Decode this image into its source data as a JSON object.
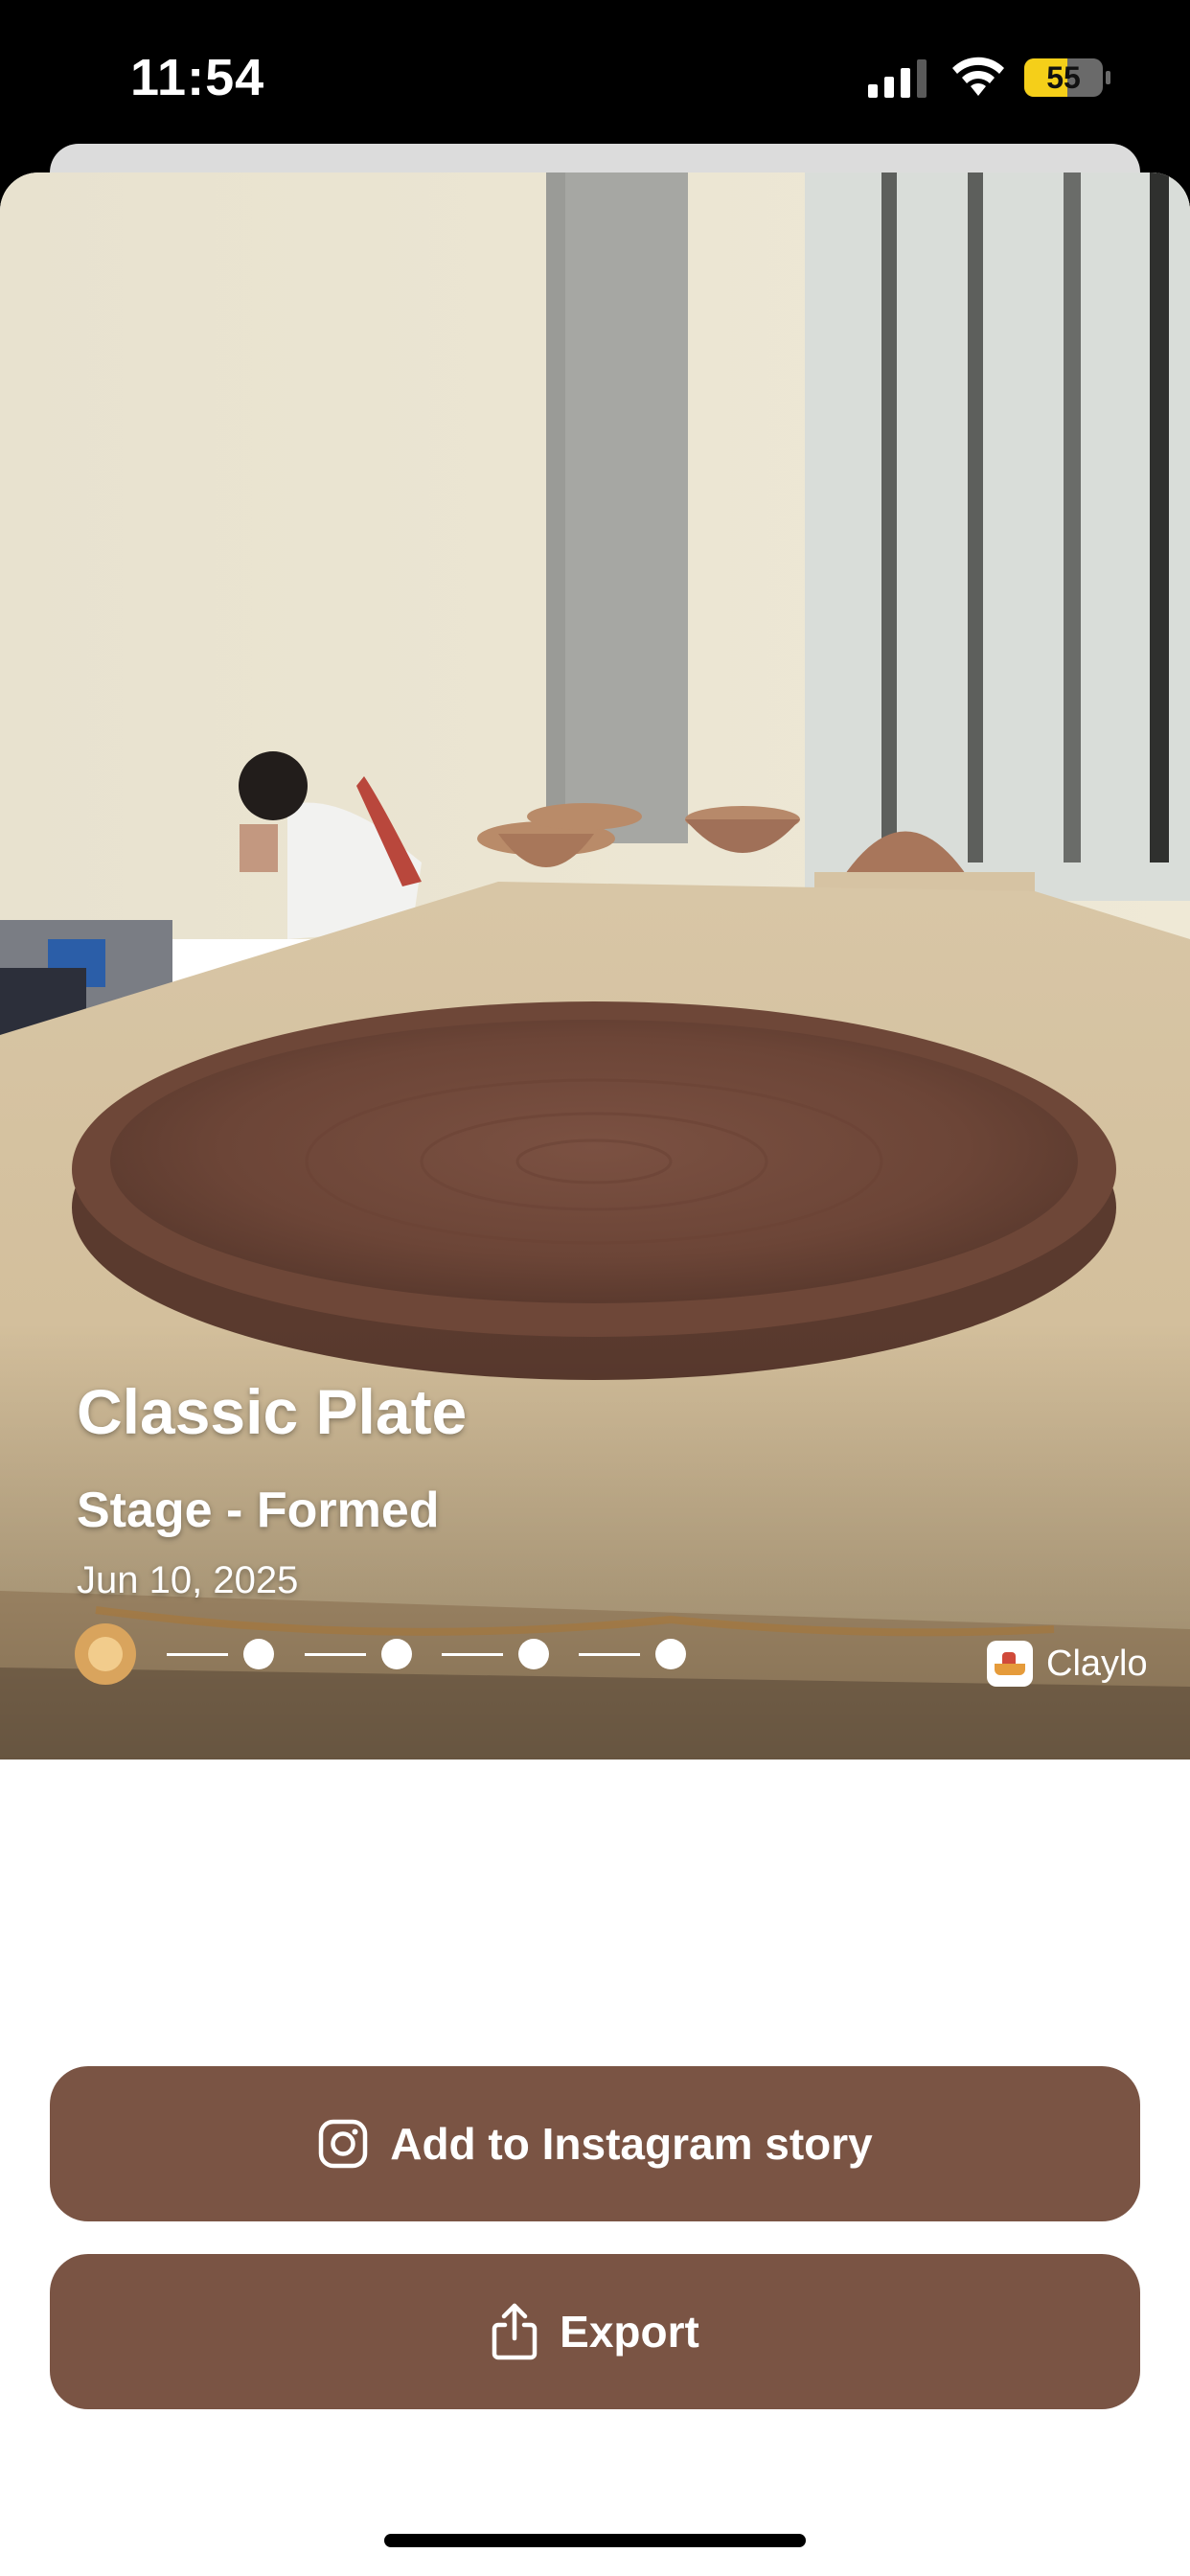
{
  "status_bar": {
    "time": "11:54",
    "battery_level": "55",
    "icons": [
      "cellular-signal-icon",
      "wifi-icon",
      "battery-icon"
    ]
  },
  "card": {
    "title": "Classic Plate",
    "stage": "Stage - Formed",
    "date": "Jun 10, 2025",
    "progress": {
      "current_step": 1,
      "total_steps": 5
    },
    "brand": "Claylo"
  },
  "actions": {
    "instagram_label": "Add to Instagram story",
    "instagram_icon": "instagram-icon",
    "export_label": "Export",
    "export_icon": "share-icon"
  },
  "colors": {
    "button": "#7a5444",
    "progress_active": "#d9a45d"
  }
}
